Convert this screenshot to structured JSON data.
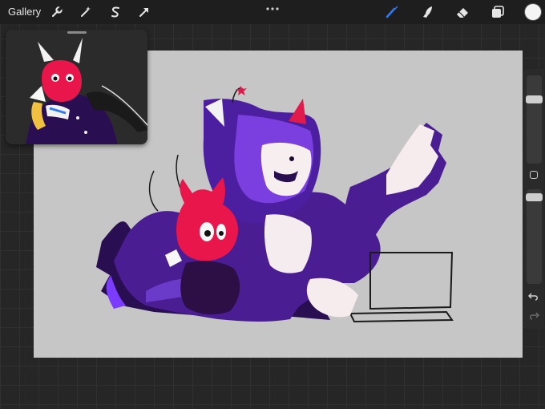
{
  "toolbar": {
    "gallery_label": "Gallery",
    "left_tools": [
      {
        "icon": "wrench-icon"
      },
      {
        "icon": "magic-wand-icon"
      },
      {
        "icon": "selection-s-icon"
      },
      {
        "icon": "transform-arrow-icon"
      }
    ],
    "more_icon": "ellipsis-icon",
    "right_tools": [
      {
        "icon": "brush-icon",
        "active": true
      },
      {
        "icon": "smudge-icon"
      },
      {
        "icon": "eraser-icon"
      },
      {
        "icon": "layers-icon"
      }
    ],
    "current_color": "#f4f4f4",
    "accent_color": "#2f7bf5"
  },
  "sidebar": {
    "brush_size_level": 0.25,
    "opacity_level": 0.05,
    "icons": [
      "modify-square-icon",
      "undo-icon",
      "redo-icon"
    ]
  },
  "canvas": {
    "background_color": "#c6c6c6"
  }
}
